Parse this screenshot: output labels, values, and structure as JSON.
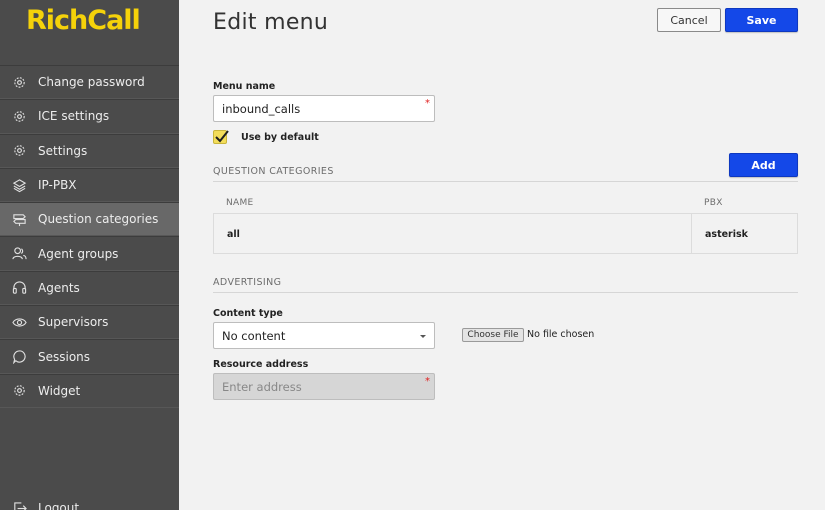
{
  "brand": {
    "name": "RichCall",
    "color": "#f5d20a"
  },
  "sidebar": {
    "items": [
      {
        "label": "Change password",
        "icon": "gear-icon"
      },
      {
        "label": "ICE settings",
        "icon": "gear-icon"
      },
      {
        "label": "Settings",
        "icon": "gear-icon"
      },
      {
        "label": "IP-PBX",
        "icon": "layers-icon"
      },
      {
        "label": "Question categories",
        "icon": "signpost-icon",
        "active": true
      },
      {
        "label": "Agent groups",
        "icon": "users-icon"
      },
      {
        "label": "Agents",
        "icon": "headset-icon"
      },
      {
        "label": "Supervisors",
        "icon": "eye-icon"
      },
      {
        "label": "Sessions",
        "icon": "chat-bubble-icon"
      },
      {
        "label": "Widget",
        "icon": "gear-icon"
      }
    ],
    "logout_label": "Logout"
  },
  "header": {
    "title": "Edit menu",
    "cancel_label": "Cancel",
    "save_label": "Save"
  },
  "form": {
    "menu_name_label": "Menu name",
    "menu_name_value": "inbound_calls",
    "required_mark": "*",
    "use_by_default_label": "Use by default",
    "use_by_default_checked": true
  },
  "question_categories": {
    "section_title": "QUESTION CATEGORIES",
    "add_label": "Add",
    "columns": [
      "NAME",
      "PBX"
    ],
    "rows": [
      {
        "name": "all",
        "pbx": "asterisk"
      }
    ]
  },
  "advertising": {
    "section_title": "ADVERTISING",
    "content_type_label": "Content type",
    "content_type_value": "No content",
    "choose_file_label": "Choose File",
    "file_status": "No file chosen",
    "resource_address_label": "Resource address",
    "resource_address_placeholder": "Enter address"
  },
  "colors": {
    "sidebar_bg": "#4b4b4b",
    "primary_button": "#1448e8",
    "checkbox": "#f3dd5a",
    "required": "#e02020"
  }
}
